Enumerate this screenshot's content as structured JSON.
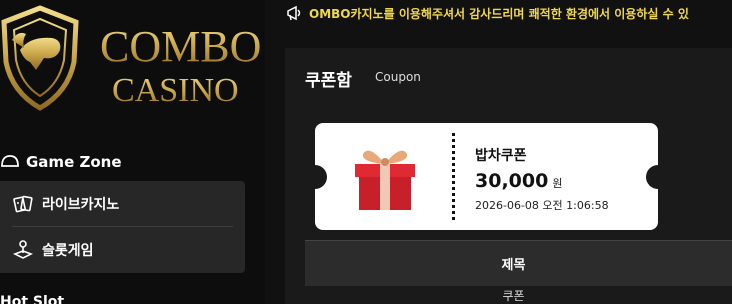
{
  "brand": {
    "logo_word_1": "COMBO",
    "logo_word_2": "CASINO",
    "gold": "#d4b75e"
  },
  "sidebar": {
    "section_title": "Game Zone",
    "section_icon": "cards-icon",
    "items": [
      {
        "label": "라이브카지노",
        "icon": "playing-cards-icon"
      },
      {
        "label": "슬롯게임",
        "icon": "joystick-icon"
      }
    ],
    "next_section_title": "Hot Slot"
  },
  "notice": {
    "icon": "megaphone-icon",
    "text": "OMBO카지노를 이용해주셔서 감사드리며 쾌적한 환경에서 이용하실 수 있"
  },
  "coupon_box": {
    "title": "쿠폰함",
    "subtitle": "Coupon",
    "coupon": {
      "name": "밥차쿠폰",
      "amount": "30,000",
      "currency": "원",
      "date": "2026-06-08 오전 1:06:58",
      "icon": "gift-box-icon"
    }
  },
  "table": {
    "header": "제목",
    "rows": [
      "쿠폰"
    ]
  }
}
